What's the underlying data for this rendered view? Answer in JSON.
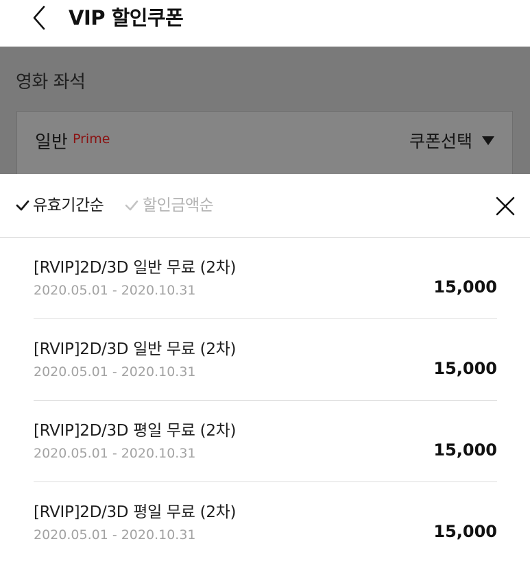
{
  "header": {
    "back_icon": "chevron-left-icon",
    "title": "VIP 할인쿠폰"
  },
  "section": {
    "title": "영화 좌석",
    "seat_label": "일반",
    "seat_grade": "Prime",
    "coupon_select_label": "쿠폰선택",
    "caret_icon": "caret-down-icon"
  },
  "sort": {
    "options": [
      {
        "label": "유효기간순",
        "active": true
      },
      {
        "label": "할인금액순",
        "active": false
      }
    ],
    "close_icon": "close-icon"
  },
  "coupons": [
    {
      "name": "[RVIP]2D/3D 일반 무료 (2차)",
      "period": "2020.05.01 - 2020.10.31",
      "amount": "15,000"
    },
    {
      "name": "[RVIP]2D/3D 일반 무료 (2차)",
      "period": "2020.05.01 - 2020.10.31",
      "amount": "15,000"
    },
    {
      "name": "[RVIP]2D/3D 평일 무료 (2차)",
      "period": "2020.05.01 - 2020.10.31",
      "amount": "15,000"
    },
    {
      "name": "[RVIP]2D/3D 평일 무료 (2차)",
      "period": "2020.05.01 - 2020.10.31",
      "amount": "15,000"
    }
  ],
  "colors": {
    "overlay": "#7a7a7a",
    "grade": "#8a1212",
    "inactive": "#b3b3b3"
  }
}
